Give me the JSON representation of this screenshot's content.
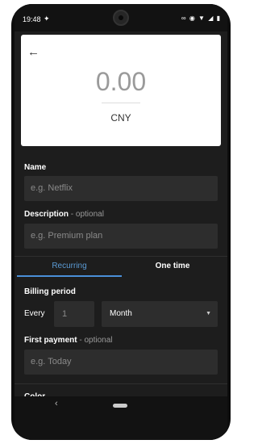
{
  "status": {
    "time": "19:48",
    "icons": [
      "twitter-icon",
      "infinity-icon",
      "eye-icon",
      "wifi-icon",
      "signal-icon",
      "battery-icon"
    ]
  },
  "amount": {
    "value": "0.00",
    "currency": "CNY"
  },
  "name": {
    "label": "Name",
    "placeholder": "e.g. Netflix"
  },
  "description": {
    "label": "Description",
    "optional": "- optional",
    "placeholder": "e.g. Premium plan"
  },
  "tabs": {
    "recurring": "Recurring",
    "one_time": "One time"
  },
  "billing": {
    "label": "Billing period",
    "every": "Every",
    "count": "1",
    "period": "Month"
  },
  "first_payment": {
    "label": "First payment",
    "optional": "- optional",
    "placeholder": "e.g. Today"
  },
  "partial_label": "Color",
  "colors": {
    "accent": "#4a8fd8",
    "background": "#1d1d1d",
    "field": "#2d2d2d"
  }
}
